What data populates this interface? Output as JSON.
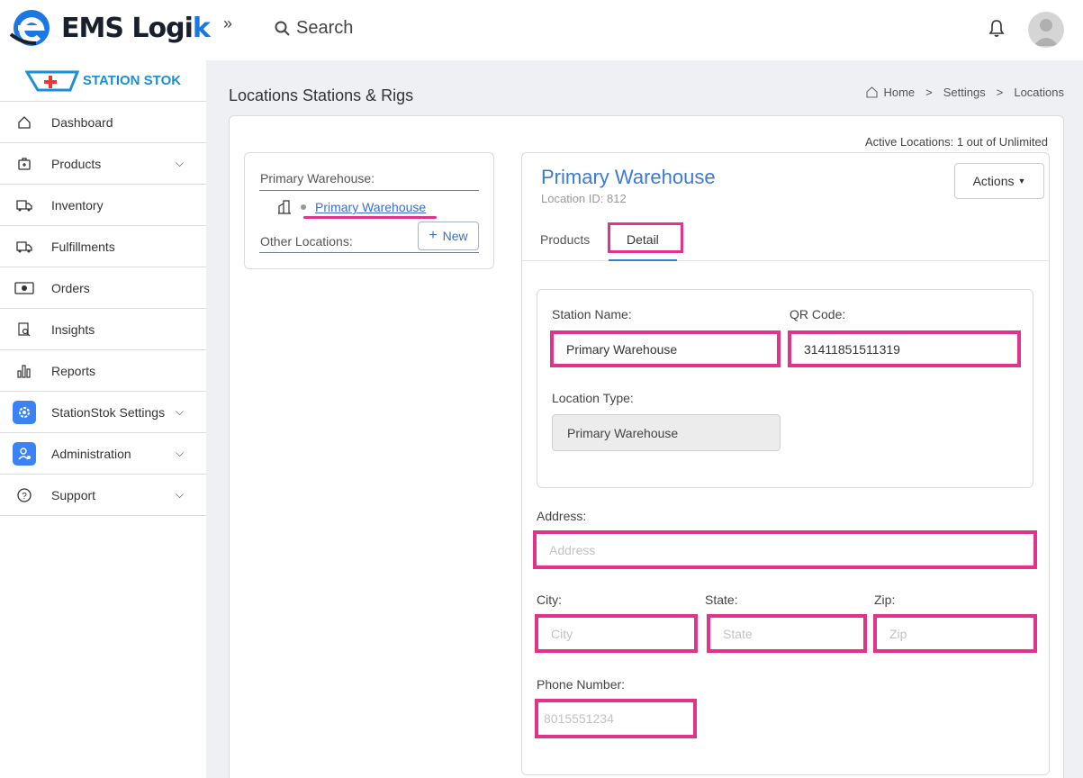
{
  "app": {
    "logo_text_main": "EMS Logi",
    "logo_text_accent": "k",
    "search_label": "Search"
  },
  "sidebar": {
    "brand": "STATION STOK",
    "items": [
      {
        "label": "Dashboard",
        "icon": "home-icon",
        "chevron": false
      },
      {
        "label": "Products",
        "icon": "medkit-icon",
        "chevron": true
      },
      {
        "label": "Inventory",
        "icon": "ambulance-icon",
        "chevron": false
      },
      {
        "label": "Fulfillments",
        "icon": "ambulance-icon",
        "chevron": false
      },
      {
        "label": "Orders",
        "icon": "money-icon",
        "chevron": false
      },
      {
        "label": "Insights",
        "icon": "report-search-icon",
        "chevron": false
      },
      {
        "label": "Reports",
        "icon": "bar-chart-icon",
        "chevron": false
      },
      {
        "label": "StationStok Settings",
        "icon": "gear-icon",
        "chevron": true
      },
      {
        "label": "Administration",
        "icon": "admin-user-icon",
        "chevron": true
      },
      {
        "label": "Support",
        "icon": "help-circle-icon",
        "chevron": true
      }
    ]
  },
  "page": {
    "title": "Locations Stations & Rigs",
    "breadcrumb": [
      "Home",
      "Settings",
      "Locations"
    ],
    "active_locations": "Active Locations: 1 out of Unlimited"
  },
  "left_panel": {
    "primary_heading": "Primary Warehouse:",
    "primary_location": "Primary Warehouse",
    "other_heading": "Other Locations:",
    "new_button": "New"
  },
  "detail": {
    "location_name": "Primary Warehouse",
    "location_id": "Location ID: 812",
    "actions_label": "Actions",
    "tabs": [
      "Products",
      "Detail"
    ],
    "active_tab": "Detail",
    "station_name_label": "Station Name:",
    "station_name_value": "Primary Warehouse",
    "qr_code_label": "QR Code:",
    "qr_code_value": "31411851511319",
    "location_type_label": "Location Type:",
    "location_type_value": "Primary Warehouse",
    "address_label": "Address:",
    "address_placeholder": "Address",
    "city_label": "City:",
    "city_placeholder": "City",
    "state_label": "State:",
    "state_placeholder": "State",
    "zip_label": "Zip:",
    "zip_placeholder": "Zip",
    "phone_label": "Phone Number:",
    "phone_placeholder": "8015551234"
  },
  "colors": {
    "highlight": "#e0348a",
    "accent": "#3a7bd5",
    "brand": "#1b78e2"
  }
}
